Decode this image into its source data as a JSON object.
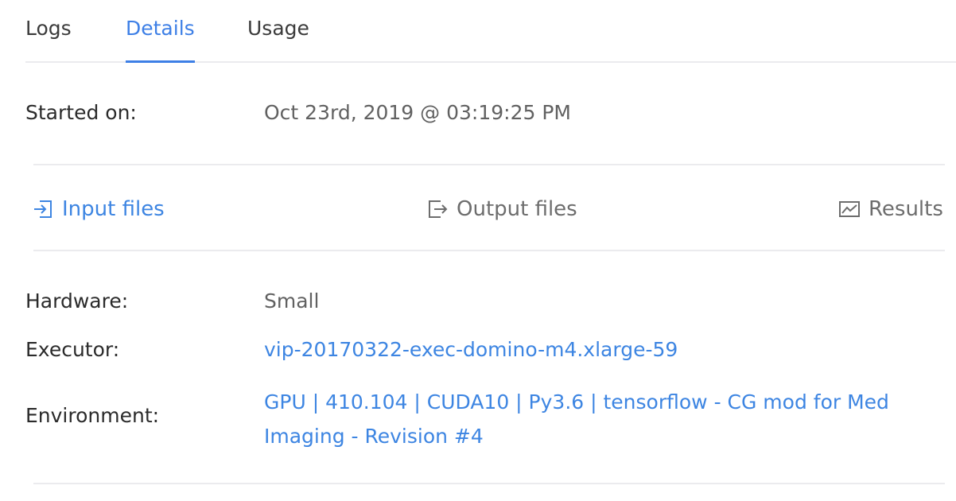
{
  "tabs": [
    {
      "label": "Logs",
      "active": false
    },
    {
      "label": "Details",
      "active": true
    },
    {
      "label": "Usage",
      "active": false
    }
  ],
  "started": {
    "label": "Started on:",
    "value": "Oct 23rd, 2019 @ 03:19:25 PM"
  },
  "files": {
    "input": {
      "label": "Input files",
      "icon": "input-file-icon"
    },
    "output": {
      "label": "Output files",
      "icon": "output-file-icon"
    },
    "results": {
      "label": "Results",
      "icon": "chart-icon"
    }
  },
  "details": {
    "hardware": {
      "label": "Hardware:",
      "value": "Small"
    },
    "executor": {
      "label": "Executor:",
      "value": "vip-20170322-exec-domino-m4.xlarge-59"
    },
    "environment": {
      "label": "Environment:",
      "value": "GPU | 410.104 | CUDA10 | Py3.6 | tensorflow - CG mod for Med Imaging - Revision #4"
    }
  },
  "colors": {
    "accent": "#3d85e2",
    "text": "#2b2b2b",
    "muted": "#616161",
    "divider": "#ebebee"
  }
}
